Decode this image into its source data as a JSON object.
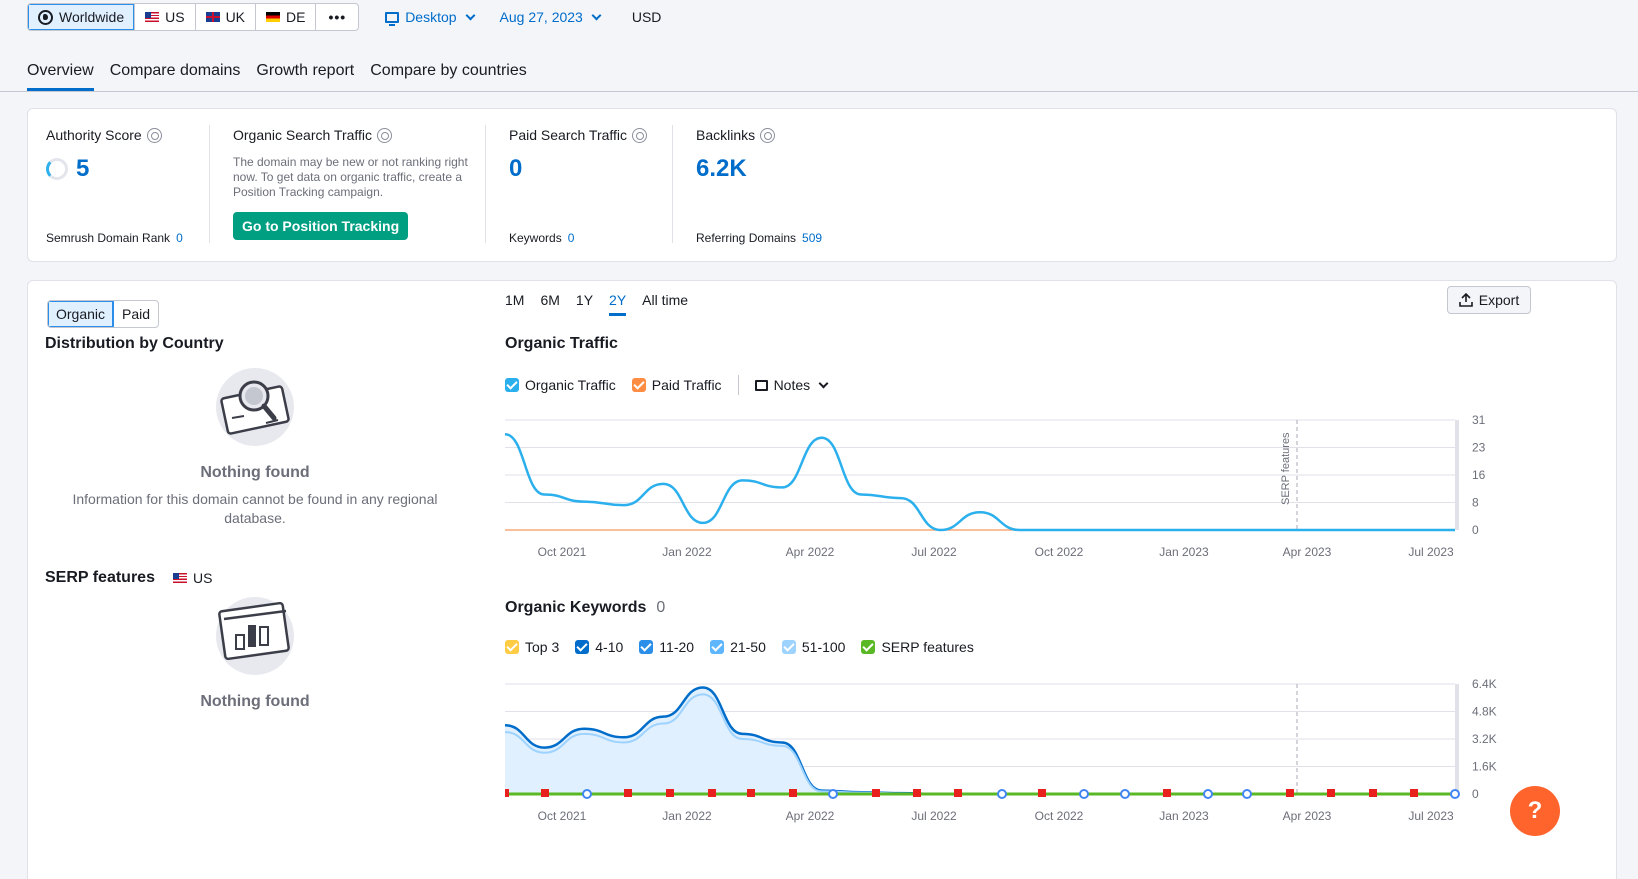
{
  "filters": {
    "databases": [
      {
        "label": "Worldwide",
        "icon": "globe-icon",
        "active": true
      },
      {
        "label": "US",
        "icon": "flag-us-icon"
      },
      {
        "label": "UK",
        "icon": "flag-uk-icon"
      },
      {
        "label": "DE",
        "icon": "flag-de-icon"
      },
      {
        "label": "•••",
        "icon": "more-icon"
      }
    ],
    "device": "Desktop",
    "date": "Aug 27, 2023",
    "currency": "USD"
  },
  "tabs": [
    "Overview",
    "Compare domains",
    "Growth report",
    "Compare by countries"
  ],
  "summary": {
    "authority": {
      "title": "Authority Score",
      "value": "5",
      "sub_label": "Semrush Domain Rank",
      "sub_value": "0"
    },
    "organic": {
      "title": "Organic Search Traffic",
      "note": "The domain may be new or not ranking right now. To get data on organic traffic, create a Position Tracking campaign.",
      "cta": "Go to Position Tracking"
    },
    "paid": {
      "title": "Paid Search Traffic",
      "value": "0",
      "sub_label": "Keywords",
      "sub_value": "0"
    },
    "backlinks": {
      "title": "Backlinks",
      "value": "6.2K",
      "sub_label": "Referring Domains",
      "sub_value": "509"
    }
  },
  "main": {
    "segment": [
      "Organic",
      "Paid"
    ],
    "distribution_title": "Distribution by Country",
    "empty_title": "Nothing found",
    "empty_desc": "Information for this domain cannot be found in any regional database.",
    "serp_title": "SERP features",
    "serp_db": "US",
    "serp_empty": "Nothing found",
    "periods": [
      "1M",
      "6M",
      "1Y",
      "2Y",
      "All time"
    ],
    "active_period": "2Y",
    "export_label": "Export",
    "traffic_title": "Organic Traffic",
    "traffic_legend": [
      "Organic Traffic",
      "Paid Traffic",
      "Notes"
    ],
    "keywords_title": "Organic Keywords",
    "keywords_count": "0",
    "keywords_legend": [
      "Top 3",
      "4-10",
      "11-20",
      "21-50",
      "51-100",
      "SERP features"
    ],
    "serp_marker": "SERP features",
    "help": "?"
  },
  "colors": {
    "organic": "#2bb0ed",
    "paid": "#ff8c43",
    "top3": "#ffcc44",
    "k4_10": "#006dca",
    "k11_20": "#2b8ee8",
    "k21_50": "#5eb6ff",
    "k51_100": "#9ed2ff",
    "serp": "#59b823"
  },
  "chart_data": [
    {
      "type": "line",
      "title": "Organic Traffic",
      "x_ticks": [
        "Oct 2021",
        "Jan 2022",
        "Apr 2022",
        "Jul 2022",
        "Oct 2022",
        "Jan 2023",
        "Apr 2023",
        "Jul 2023"
      ],
      "y_ticks": [
        0,
        8,
        16,
        23,
        31
      ],
      "ylim": [
        0,
        31
      ],
      "series": [
        {
          "name": "Organic Traffic",
          "values": [
            27,
            10,
            8,
            7,
            13,
            2,
            14,
            12,
            26,
            10,
            9,
            0,
            5,
            0,
            0,
            0,
            0,
            0,
            0,
            0,
            0,
            0,
            0,
            0,
            0
          ]
        },
        {
          "name": "Paid Traffic",
          "values": [
            0,
            0,
            0,
            0,
            0,
            0,
            0,
            0,
            0,
            0,
            0,
            0,
            0,
            0,
            0,
            0,
            0,
            0,
            0,
            0,
            0,
            0,
            0,
            0,
            0
          ]
        }
      ]
    },
    {
      "type": "area",
      "title": "Organic Keywords",
      "x_ticks": [
        "Oct 2021",
        "Jan 2022",
        "Apr 2022",
        "Jul 2022",
        "Oct 2022",
        "Jan 2023",
        "Apr 2023",
        "Jul 2023"
      ],
      "y_ticks": [
        "0",
        "1.6K",
        "3.2K",
        "4.8K",
        "6.4K"
      ],
      "ylim": [
        0,
        6400
      ],
      "series": [
        {
          "name": "51-100",
          "values": [
            4000,
            2700,
            3800,
            3300,
            4500,
            6200,
            3500,
            3000,
            200,
            100,
            50,
            0,
            0,
            0,
            0,
            0,
            0,
            0,
            0,
            0,
            0,
            0,
            0,
            0,
            0
          ]
        },
        {
          "name": "21-50",
          "values": [
            3600,
            2400,
            3500,
            3000,
            4100,
            5800,
            3200,
            2800,
            150,
            80,
            40,
            0,
            0,
            0,
            0,
            0,
            0,
            0,
            0,
            0,
            0,
            0,
            0,
            0,
            0
          ]
        }
      ]
    }
  ]
}
